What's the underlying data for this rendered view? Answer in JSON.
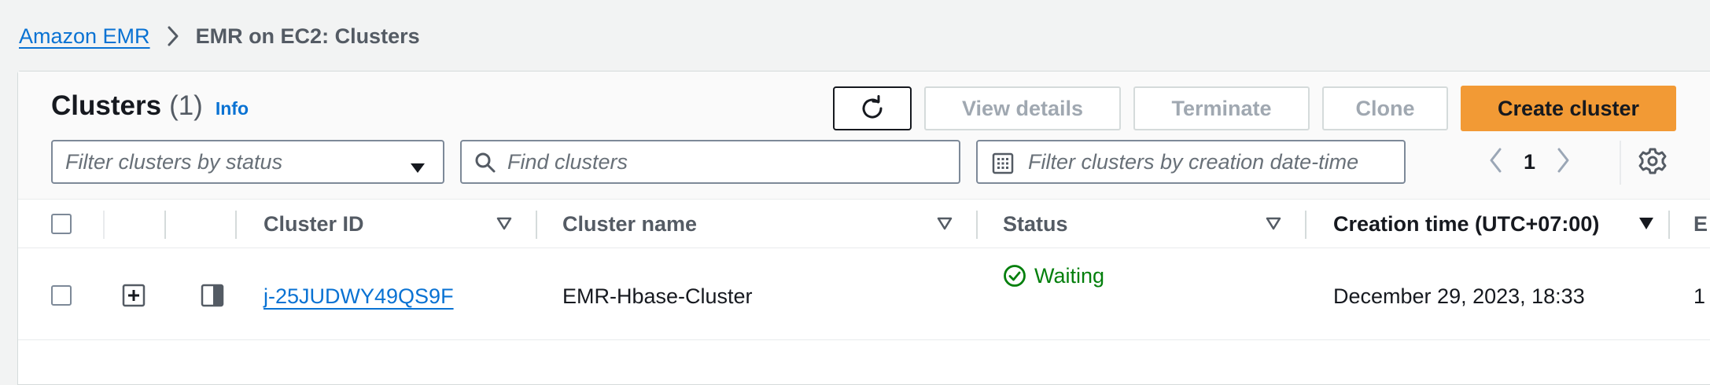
{
  "breadcrumb": {
    "root": "Amazon EMR",
    "current": "EMR on EC2: Clusters"
  },
  "header": {
    "title": "Clusters",
    "count": "(1)",
    "info": "Info"
  },
  "actions": {
    "view_details": "View details",
    "terminate": "Terminate",
    "clone": "Clone",
    "create_cluster": "Create cluster"
  },
  "filters": {
    "status_placeholder": "Filter clusters by status",
    "search_placeholder": "Find clusters",
    "date_placeholder": "Filter clusters by creation date-time"
  },
  "pagination": {
    "current_page": "1"
  },
  "table": {
    "columns": {
      "cluster_id": "Cluster ID",
      "cluster_name": "Cluster name",
      "status": "Status",
      "creation_time": "Creation time (UTC+07:00)",
      "next": "E"
    },
    "rows": [
      {
        "cluster_id": "j-25JUDWY49QS9F",
        "cluster_name": "EMR-Hbase-Cluster",
        "status": "Waiting",
        "creation_time": "December 29, 2023, 18:33",
        "next": "1"
      }
    ]
  },
  "colors": {
    "link": "#0972d3",
    "primary_button": "#f29a35",
    "status_ok": "#037f0c"
  }
}
